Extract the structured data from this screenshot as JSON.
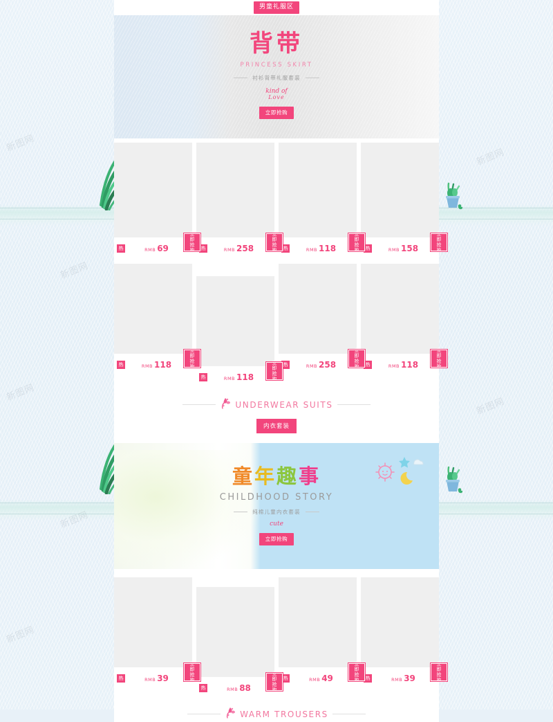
{
  "page": {
    "top_tag": "男童礼服区",
    "watermark": "新图网"
  },
  "banner1": {
    "title": "背带",
    "subtitle_en": "PRINCESS SKIRT",
    "subtitle_cn": "衬衫背带礼服套装",
    "script_line1": "kind of",
    "script_line2": "Love",
    "cta": "立即抢购"
  },
  "banner2": {
    "title_chars": [
      "童",
      "年",
      "趣",
      "事"
    ],
    "subtitle_en": "CHILDHOOD STORY",
    "subtitle_cn": "纯棉儿童内衣套装",
    "script_line1": "cute",
    "cta": "立即抢购"
  },
  "labels": {
    "currency": "RMB",
    "hot": "热",
    "buy_line1": "立即",
    "buy_line2": "抢购"
  },
  "grids": [
    {
      "id": "grid-1",
      "size": "tall",
      "items": [
        {
          "price": "69",
          "hot": "热",
          "currency": "RMB"
        },
        {
          "price": "258",
          "hot": "热",
          "currency": "RMB"
        },
        {
          "price": "118",
          "hot": "热",
          "currency": "RMB"
        },
        {
          "price": "158",
          "hot": "热",
          "currency": "RMB"
        }
      ]
    },
    {
      "id": "grid-2",
      "size": "med",
      "items": [
        {
          "price": "118",
          "hot": "热",
          "currency": "RMB"
        },
        {
          "price": "118",
          "hot": "热",
          "currency": "RMB"
        },
        {
          "price": "258",
          "hot": "热",
          "currency": "RMB"
        },
        {
          "price": "118",
          "hot": "热",
          "currency": "RMB"
        }
      ]
    },
    {
      "id": "grid-3",
      "size": "med",
      "items": [
        {
          "price": "39",
          "hot": "热",
          "currency": "RMB"
        },
        {
          "price": "88",
          "hot": "热",
          "currency": "RMB"
        },
        {
          "price": "49",
          "hot": "热",
          "currency": "RMB"
        },
        {
          "price": "39",
          "hot": "热",
          "currency": "RMB"
        }
      ]
    }
  ],
  "sections": [
    {
      "id": "section-underwear",
      "title_en": "UNDERWEAR SUITS",
      "badge_cn": "内衣套装"
    },
    {
      "id": "section-trousers",
      "title_en": "WARM TROUSERS",
      "badge_cn": ""
    }
  ],
  "colors": {
    "brand_pink": "#f2457c",
    "soft_pink": "#f2779f",
    "thumb_gray": "#efefef",
    "page_blue": "#e7f1f8",
    "banner2_blue": "#bfe2f5"
  }
}
